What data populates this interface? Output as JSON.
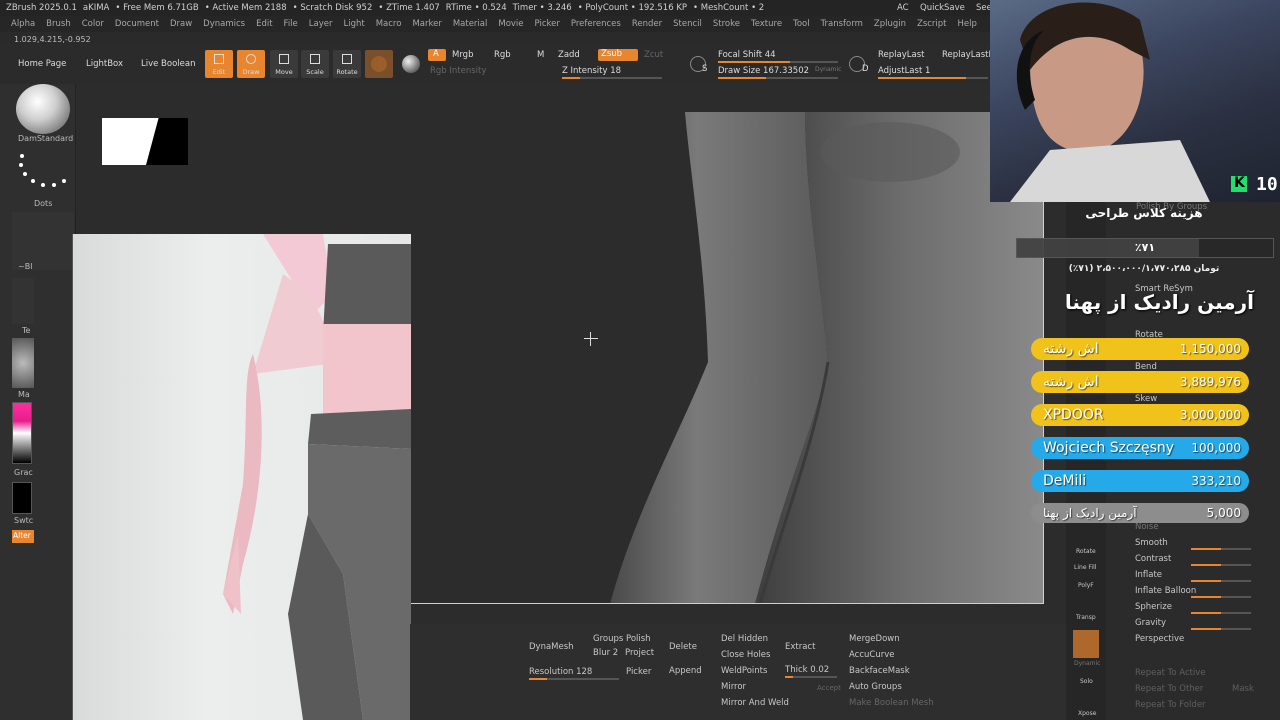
{
  "titlebar": {
    "app": "ZBrush 2025.0.1",
    "doc": "aKIMA",
    "free_mem": "• Free Mem 6.71GB",
    "active_mem": "• Active Mem 2188",
    "scratch_disk": "• Scratch Disk 952",
    "ztime": "• ZTime 1.407",
    "rtime": "RTime • 0.524",
    "timer": "Timer • 3.246",
    "polycount": "• PolyCount • 192.516 KP",
    "meshcount": "• MeshCount • 2",
    "ac": "AC",
    "quicksave": "QuickSave",
    "see": "See"
  },
  "menu": [
    "Alpha",
    "Brush",
    "Color",
    "Document",
    "Draw",
    "Dynamics",
    "Edit",
    "File",
    "Layer",
    "Light",
    "Macro",
    "Marker",
    "Material",
    "Movie",
    "Picker",
    "Preferences",
    "Render",
    "Stencil",
    "Stroke",
    "Texture",
    "Tool",
    "Transform",
    "Zplugin",
    "Zscript",
    "Help"
  ],
  "coords": "1.029,4.215,-0.952",
  "toolbar": {
    "home_page": "Home Page",
    "lightbox": "LightBox",
    "live_boolean": "Live Boolean",
    "edit": "Edit",
    "draw": "Draw",
    "move": "Move",
    "scale": "Scale",
    "rotate": "Rotate",
    "a": "A",
    "mrgb": "Mrgb",
    "rgb": "Rgb",
    "m": "M",
    "zadd": "Zadd",
    "zsub": "Zsub",
    "zcut": "Zcut",
    "rgb_intensity": "Rgb Intensity",
    "z_intensity": "Z Intensity 18",
    "focal_shift": "Focal Shift 44",
    "draw_size": "Draw Size 167.33502",
    "dynamic": "Dynamic",
    "replay_last": "ReplayLast",
    "replay_last_rel": "ReplayLastRe",
    "adjust_last": "AdjustLast 1",
    "s": "S",
    "d": "D"
  },
  "lefttray": {
    "brush_name": "DamStandard",
    "stroke_name": "Dots",
    "alpha_label": "~Bl",
    "texture_label": "Te",
    "material_label": "Ma",
    "gradient_label": "Grac",
    "switch_label": "Swtc",
    "alternate_label": "Alter"
  },
  "bottom": {
    "dynamesh": "DynaMesh",
    "groups": "Groups",
    "polish": "Polish",
    "blur": "Blur 2",
    "project": "Project",
    "resolution": "Resolution 128",
    "delete": "Delete",
    "picker": "Picker",
    "append": "Append",
    "del_hidden": "Del Hidden",
    "close_holes": "Close Holes",
    "weld_points": "WeldPoints",
    "mirror": "Mirror",
    "mirror_and_weld": "Mirror And Weld",
    "extract": "Extract",
    "thick": "Thick 0.02",
    "accept": "Accept",
    "merge_down": "MergeDown",
    "accucurve": "AccuCurve",
    "backface_mask": "BackfaceMask",
    "auto_groups": "Auto Groups",
    "make_boolean_mesh": "Make Boolean Mesh"
  },
  "righttray": {
    "polish_by_groups": "Polish By Groups",
    "smart_resym": "Smart ReSym",
    "rotate_item": "Rotate",
    "bend": "Bend",
    "skew": "Skew",
    "noise": "Noise",
    "smooth": "Smooth",
    "contrast": "Contrast",
    "inflate": "Inflate",
    "inflate_balloon": "Inflate Balloon",
    "spherize": "Spherize",
    "gravity": "Gravity",
    "perspective": "Perspective",
    "repeat_to_active": "Repeat To Active",
    "repeat_to_other": "Repeat To Other",
    "mask": "Mask",
    "repeat_to_folder": "Repeat To Folder",
    "side_rotate": "Rotate",
    "side_linefill": "Line Fill",
    "side_polyf": "PolyF",
    "side_transp": "Transp",
    "side_dynamic": "Dynamic",
    "side_solo": "Solo",
    "side_xpose": "Xpose"
  },
  "webcam": {
    "count": "10",
    "k_label": "K"
  },
  "donation": {
    "header": "هزینه کلاس طراحی",
    "percent": "٪۷۱",
    "progress_text": "(٪۷۱) ۲،۵۰۰،۰۰۰/۱،۷۷۰،۲۸۵ تومان",
    "title": "آرمین رادیک از پهنا",
    "progress_fraction": 0.71,
    "donors": [
      {
        "name": "اش رشته",
        "amount": "1,150,000",
        "color": "#f0c21a"
      },
      {
        "name": "اش رشته",
        "amount": "3,889,976",
        "color": "#f0c21a"
      },
      {
        "name": "XPDOOR",
        "amount": "3,000,000",
        "color": "#f0c21a"
      },
      {
        "name": "Wojciech Szczęsny",
        "amount": "100,000",
        "color": "#25a9e8"
      },
      {
        "name": "DeMili",
        "amount": "333,210",
        "color": "#25a9e8"
      },
      {
        "name": "آرمین رادیک از پهنا",
        "amount": "5,000",
        "color": "#8d8d8d"
      }
    ]
  },
  "colors": {
    "accent": "#e8852f",
    "panel": "#2b2b2b",
    "titlebar": "#242424"
  }
}
